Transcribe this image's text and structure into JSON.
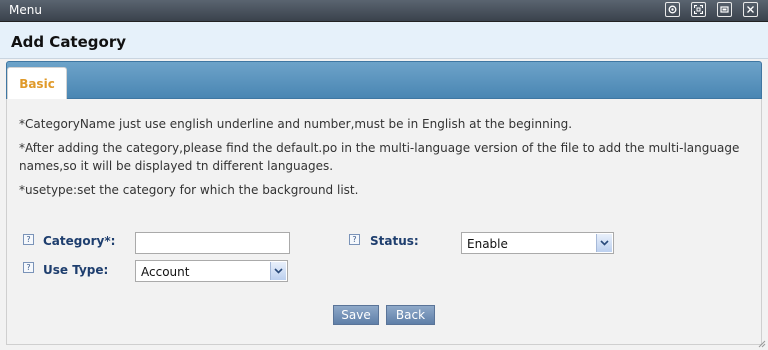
{
  "window": {
    "title": "Menu",
    "buttons": [
      "pin-icon",
      "fullscreen-icon",
      "minimize-icon",
      "close-icon"
    ]
  },
  "page": {
    "heading": "Add Category",
    "tabs": [
      {
        "label": "Basic"
      }
    ]
  },
  "notes": [
    "*CategoryName just use english underline and number,must be in English at the beginning.",
    "*After adding the category,please find the default.po in the multi-language version of the file to add the multi-language names,so it will be displayed tn different languages.",
    "*usetype:set the category for which the background list."
  ],
  "form": {
    "category": {
      "label": "Category*:",
      "value": ""
    },
    "status": {
      "label": "Status:",
      "value": "Enable"
    },
    "use_type": {
      "label": "Use Type:",
      "value": "Account"
    },
    "help_glyph": "?"
  },
  "buttons": {
    "save": "Save",
    "back": "Back"
  },
  "colors": {
    "titlebar": "#3f4852",
    "header_bg": "#e6f1fa",
    "tabbar": "#5a94be",
    "tab_text": "#e09a2a",
    "label": "#1e3e6e",
    "button": "#7391b8"
  }
}
